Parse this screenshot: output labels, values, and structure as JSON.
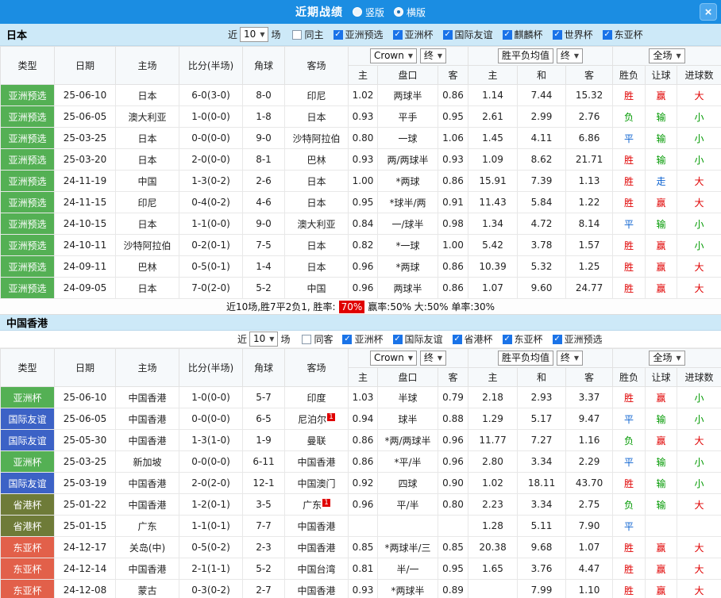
{
  "topbar": {
    "title": "近期战绩",
    "layout_options": [
      {
        "label": "竖版",
        "selected": false
      },
      {
        "label": "横版",
        "selected": true
      }
    ],
    "close_icon": "×",
    "bar_color": "#1b8de2"
  },
  "columns": {
    "type": "类型",
    "date": "日期",
    "home": "主场",
    "score": "比分(半场)",
    "corner": "角球",
    "away": "客场",
    "odds_book": "Crown",
    "odds_final": "终",
    "avg_label": "胜平负均值",
    "avg_final": "终",
    "scope": "全场",
    "sub_home": "主",
    "sub_handicap": "盘口",
    "sub_away": "客",
    "sub_avg_home": "主",
    "sub_avg_draw": "和",
    "sub_avg_away": "客",
    "sub_result": "胜负",
    "sub_handicap_result": "让球",
    "sub_goals": "进球数"
  },
  "type_colors": {
    "亚洲预选": "#54b054",
    "亚洲杯": "#54b054",
    "国际友谊": "#3c62c6",
    "省港杯": "#6e7b38",
    "东亚杯": "#e2604a"
  },
  "result_colors": {
    "胜": "#e00000",
    "赢": "#e00000",
    "大": "#e00000",
    "负": "#009900",
    "输": "#009900",
    "小": "#009900",
    "平": "#0b62d0",
    "走": "#0b62d0"
  },
  "sections": [
    {
      "team": "日本",
      "filter": {
        "near_label": "近",
        "count": "10",
        "games_label": "场",
        "checkboxes": [
          {
            "label": "同主",
            "checked": false
          },
          {
            "label": "亚洲预选",
            "checked": true
          },
          {
            "label": "亚洲杯",
            "checked": true
          },
          {
            "label": "国际友谊",
            "checked": true
          },
          {
            "label": "麒麟杯",
            "checked": true
          },
          {
            "label": "世界杯",
            "checked": true
          },
          {
            "label": "东亚杯",
            "checked": true
          }
        ]
      },
      "rows": [
        {
          "type": "亚洲预选",
          "date": "25-06-10",
          "home": "日本",
          "hg": true,
          "hb": "",
          "score": "6-0(3-0)",
          "corner": "8-0",
          "away": "印尼",
          "ag": false,
          "ab": "",
          "o1": "1.02",
          "hc": "两球半",
          "o2": "0.86",
          "m1": "1.14",
          "m2": "7.44",
          "m3": "15.32",
          "r1": "胜",
          "r2": "赢",
          "r3": "大"
        },
        {
          "type": "亚洲预选",
          "date": "25-06-05",
          "home": "澳大利亚",
          "hg": false,
          "hb": "",
          "score": "1-0(0-0)",
          "corner": "1-8",
          "away": "日本",
          "ag": true,
          "ab": "",
          "o1": "0.93",
          "hc": "平手",
          "o2": "0.95",
          "m1": "2.61",
          "m2": "2.99",
          "m3": "2.76",
          "r1": "负",
          "r2": "输",
          "r3": "小"
        },
        {
          "type": "亚洲预选",
          "date": "25-03-25",
          "home": "日本",
          "hg": true,
          "hb": "",
          "score": "0-0(0-0)",
          "corner": "9-0",
          "away": "沙特阿拉伯",
          "ag": false,
          "ab": "",
          "o1": "0.80",
          "hc": "一球",
          "o2": "1.06",
          "m1": "1.45",
          "m2": "4.11",
          "m3": "6.86",
          "r1": "平",
          "r2": "输",
          "r3": "小"
        },
        {
          "type": "亚洲预选",
          "date": "25-03-20",
          "home": "日本",
          "hg": true,
          "hb": "",
          "score": "2-0(0-0)",
          "corner": "8-1",
          "away": "巴林",
          "ag": false,
          "ab": "",
          "o1": "0.93",
          "hc": "两/两球半",
          "o2": "0.93",
          "m1": "1.09",
          "m2": "8.62",
          "m3": "21.71",
          "r1": "胜",
          "r2": "输",
          "r3": "小"
        },
        {
          "type": "亚洲预选",
          "date": "24-11-19",
          "home": "中国",
          "hg": false,
          "hb": "",
          "score": "1-3(0-2)",
          "corner": "2-6",
          "away": "日本",
          "ag": true,
          "ab": "",
          "o1": "1.00",
          "hc": "*两球",
          "o2": "0.86",
          "m1": "15.91",
          "m2": "7.39",
          "m3": "1.13",
          "r1": "胜",
          "r2": "走",
          "r3": "大"
        },
        {
          "type": "亚洲预选",
          "date": "24-11-15",
          "home": "印尼",
          "hg": false,
          "hb": "",
          "score": "0-4(0-2)",
          "corner": "4-6",
          "away": "日本",
          "ag": true,
          "ab": "",
          "o1": "0.95",
          "hc": "*球半/两",
          "o2": "0.91",
          "m1": "11.43",
          "m2": "5.84",
          "m3": "1.22",
          "r1": "胜",
          "r2": "赢",
          "r3": "大"
        },
        {
          "type": "亚洲预选",
          "date": "24-10-15",
          "home": "日本",
          "hg": true,
          "hb": "",
          "score": "1-1(0-0)",
          "corner": "9-0",
          "away": "澳大利亚",
          "ag": false,
          "ab": "",
          "o1": "0.84",
          "hc": "一/球半",
          "o2": "0.98",
          "m1": "1.34",
          "m2": "4.72",
          "m3": "8.14",
          "r1": "平",
          "r2": "输",
          "r3": "小"
        },
        {
          "type": "亚洲预选",
          "date": "24-10-11",
          "home": "沙特阿拉伯",
          "hg": false,
          "hb": "",
          "score": "0-2(0-1)",
          "corner": "7-5",
          "away": "日本",
          "ag": true,
          "ab": "",
          "o1": "0.82",
          "hc": "*一球",
          "o2": "1.00",
          "m1": "5.42",
          "m2": "3.78",
          "m3": "1.57",
          "r1": "胜",
          "r2": "赢",
          "r3": "小"
        },
        {
          "type": "亚洲预选",
          "date": "24-09-11",
          "home": "巴林",
          "hg": false,
          "hb": "",
          "score": "0-5(0-1)",
          "corner": "1-4",
          "away": "日本",
          "ag": true,
          "ab": "",
          "o1": "0.96",
          "hc": "*两球",
          "o2": "0.86",
          "m1": "10.39",
          "m2": "5.32",
          "m3": "1.25",
          "r1": "胜",
          "r2": "赢",
          "r3": "大"
        },
        {
          "type": "亚洲预选",
          "date": "24-09-05",
          "home": "日本",
          "hg": true,
          "hb": "",
          "score": "7-0(2-0)",
          "corner": "5-2",
          "away": "中国",
          "ag": false,
          "ab": "",
          "o1": "0.96",
          "hc": "两球半",
          "o2": "0.86",
          "m1": "1.07",
          "m2": "9.60",
          "m3": "24.77",
          "r1": "胜",
          "r2": "赢",
          "r3": "大"
        }
      ],
      "summary": {
        "prefix": "近10场,胜7平2负1, 胜率:",
        "win_rate": "70%",
        "suffix": "赢率:50% 大:50% 单率:30%"
      }
    },
    {
      "team": "中国香港",
      "filter": {
        "near_label": "近",
        "count": "10",
        "games_label": "场",
        "checkboxes": [
          {
            "label": "同客",
            "checked": false
          },
          {
            "label": "亚洲杯",
            "checked": true
          },
          {
            "label": "国际友谊",
            "checked": true
          },
          {
            "label": "省港杯",
            "checked": true
          },
          {
            "label": "东亚杯",
            "checked": true
          },
          {
            "label": "亚洲预选",
            "checked": true
          }
        ]
      },
      "rows": [
        {
          "type": "亚洲杯",
          "date": "25-06-10",
          "home": "中国香港",
          "hg": true,
          "hb": "",
          "score": "1-0(0-0)",
          "corner": "5-7",
          "away": "印度",
          "ag": false,
          "ab": "",
          "o1": "1.03",
          "hc": "半球",
          "o2": "0.79",
          "m1": "2.18",
          "m2": "2.93",
          "m3": "3.37",
          "r1": "胜",
          "r2": "赢",
          "r3": "小"
        },
        {
          "type": "国际友谊",
          "date": "25-06-05",
          "home": "中国香港",
          "hg": true,
          "hb": "",
          "score": "0-0(0-0)",
          "corner": "6-5",
          "away": "尼泊尔",
          "ag": false,
          "ab": "1",
          "o1": "0.94",
          "hc": "球半",
          "o2": "0.88",
          "m1": "1.29",
          "m2": "5.17",
          "m3": "9.47",
          "r1": "平",
          "r2": "输",
          "r3": "小"
        },
        {
          "type": "国际友谊",
          "date": "25-05-30",
          "home": "中国香港",
          "hg": true,
          "hb": "",
          "score": "1-3(1-0)",
          "corner": "1-9",
          "away": "曼联",
          "ag": false,
          "ab": "",
          "o1": "0.86",
          "hc": "*两/两球半",
          "o2": "0.96",
          "m1": "11.77",
          "m2": "7.27",
          "m3": "1.16",
          "r1": "负",
          "r2": "赢",
          "r3": "大"
        },
        {
          "type": "亚洲杯",
          "date": "25-03-25",
          "home": "新加坡",
          "hg": false,
          "hb": "",
          "score": "0-0(0-0)",
          "corner": "6-11",
          "away": "中国香港",
          "ag": true,
          "ab": "",
          "o1": "0.86",
          "hc": "*平/半",
          "o2": "0.96",
          "m1": "2.80",
          "m2": "3.34",
          "m3": "2.29",
          "r1": "平",
          "r2": "输",
          "r3": "小"
        },
        {
          "type": "国际友谊",
          "date": "25-03-19",
          "home": "中国香港",
          "hg": true,
          "hb": "",
          "score": "2-0(2-0)",
          "corner": "12-1",
          "away": "中国澳门",
          "ag": false,
          "ab": "",
          "o1": "0.92",
          "hc": "四球",
          "o2": "0.90",
          "m1": "1.02",
          "m2": "18.11",
          "m3": "43.70",
          "r1": "胜",
          "r2": "输",
          "r3": "小"
        },
        {
          "type": "省港杯",
          "date": "25-01-22",
          "home": "中国香港",
          "hg": true,
          "hb": "",
          "score": "1-2(0-1)",
          "corner": "3-5",
          "away": "广东",
          "ag": false,
          "ab": "1",
          "o1": "0.96",
          "hc": "平/半",
          "o2": "0.80",
          "m1": "2.23",
          "m2": "3.34",
          "m3": "2.75",
          "r1": "负",
          "r2": "输",
          "r3": "大"
        },
        {
          "type": "省港杯",
          "date": "25-01-15",
          "home": "广东",
          "hg": false,
          "hb": "",
          "score": "1-1(0-1)",
          "corner": "7-7",
          "away": "中国香港",
          "ag": true,
          "ab": "",
          "o1": "",
          "hc": "",
          "o2": "",
          "m1": "1.28",
          "m2": "5.11",
          "m3": "7.90",
          "r1": "平",
          "r2": "",
          "r3": ""
        },
        {
          "type": "东亚杯",
          "date": "24-12-17",
          "home": "关岛(中)",
          "hg": false,
          "hb": "",
          "score": "0-5(0-2)",
          "corner": "2-3",
          "away": "中国香港",
          "ag": true,
          "ab": "",
          "o1": "0.85",
          "hc": "*两球半/三",
          "o2": "0.85",
          "m1": "20.38",
          "m2": "9.68",
          "m3": "1.07",
          "r1": "胜",
          "r2": "赢",
          "r3": "大"
        },
        {
          "type": "东亚杯",
          "date": "24-12-14",
          "home": "中国香港",
          "hg": true,
          "hb": "",
          "score": "2-1(1-1)",
          "corner": "5-2",
          "away": "中国台湾",
          "ag": false,
          "ab": "",
          "o1": "0.81",
          "hc": "半/一",
          "o2": "0.95",
          "m1": "1.65",
          "m2": "3.76",
          "m3": "4.47",
          "r1": "胜",
          "r2": "赢",
          "r3": "大"
        },
        {
          "type": "东亚杯",
          "date": "24-12-08",
          "home": "蒙古",
          "hg": false,
          "hb": "",
          "score": "0-3(0-2)",
          "corner": "2-7",
          "away": "中国香港",
          "ag": true,
          "ab": "",
          "o1": "0.93",
          "hc": "*两球半",
          "o2": "0.89",
          "m1": "",
          "m2": "7.99",
          "m3": "1.10",
          "r1": "胜",
          "r2": "赢",
          "r3": "大"
        }
      ]
    }
  ]
}
